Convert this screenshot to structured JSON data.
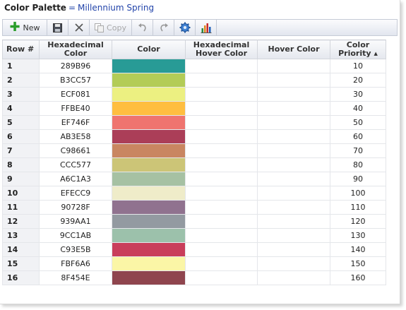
{
  "header": {
    "title": "Color Palette",
    "separator": "=",
    "palette_name": "Millennium Spring"
  },
  "toolbar": {
    "new_label": "New",
    "copy_label": "Copy",
    "icons": [
      "plus-icon",
      "save-icon",
      "delete-icon",
      "copy-icon",
      "undo-icon",
      "redo-icon",
      "settings-icon",
      "chart-icon"
    ]
  },
  "table": {
    "columns": {
      "row": "Row #",
      "hex": "Hexadecimal Color",
      "color": "Color",
      "hover_hex": "Hexadecimal Hover Color",
      "hover_color": "Hover Color",
      "priority": "Color Priority"
    },
    "sort": {
      "column": "priority",
      "direction": "ascending"
    },
    "rows": [
      {
        "row": "1",
        "hex": "289B96",
        "color": "#289B96",
        "hover_hex": "",
        "priority": "10"
      },
      {
        "row": "2",
        "hex": "B3CC57",
        "color": "#B3CC57",
        "hover_hex": "",
        "priority": "20"
      },
      {
        "row": "3",
        "hex": "ECF081",
        "color": "#ECF081",
        "hover_hex": "",
        "priority": "30"
      },
      {
        "row": "4",
        "hex": "FFBE40",
        "color": "#FFBE40",
        "hover_hex": "",
        "priority": "40"
      },
      {
        "row": "5",
        "hex": "EF746F",
        "color": "#EF746F",
        "hover_hex": "",
        "priority": "50"
      },
      {
        "row": "6",
        "hex": "AB3E58",
        "color": "#AB3E58",
        "hover_hex": "",
        "priority": "60"
      },
      {
        "row": "7",
        "hex": "C98661",
        "color": "#C98661",
        "hover_hex": "",
        "priority": "70"
      },
      {
        "row": "8",
        "hex": "CCC577",
        "color": "#CCC577",
        "hover_hex": "",
        "priority": "80"
      },
      {
        "row": "9",
        "hex": "A6C1A3",
        "color": "#A6C1A3",
        "hover_hex": "",
        "priority": "90"
      },
      {
        "row": "10",
        "hex": "EFECC9",
        "color": "#EFECC9",
        "hover_hex": "",
        "priority": "100"
      },
      {
        "row": "11",
        "hex": "90728F",
        "color": "#90728F",
        "hover_hex": "",
        "priority": "110"
      },
      {
        "row": "12",
        "hex": "939AA1",
        "color": "#939AA1",
        "hover_hex": "",
        "priority": "120"
      },
      {
        "row": "13",
        "hex": "9CC1AB",
        "color": "#9CC1AB",
        "hover_hex": "",
        "priority": "130"
      },
      {
        "row": "14",
        "hex": "C93E5B",
        "color": "#C93E5B",
        "hover_hex": "",
        "priority": "140"
      },
      {
        "row": "15",
        "hex": "FBF6A6",
        "color": "#FBF6A6",
        "hover_hex": "",
        "priority": "150"
      },
      {
        "row": "16",
        "hex": "8F454E",
        "color": "#8F454E",
        "hover_hex": "",
        "priority": "160"
      }
    ]
  }
}
